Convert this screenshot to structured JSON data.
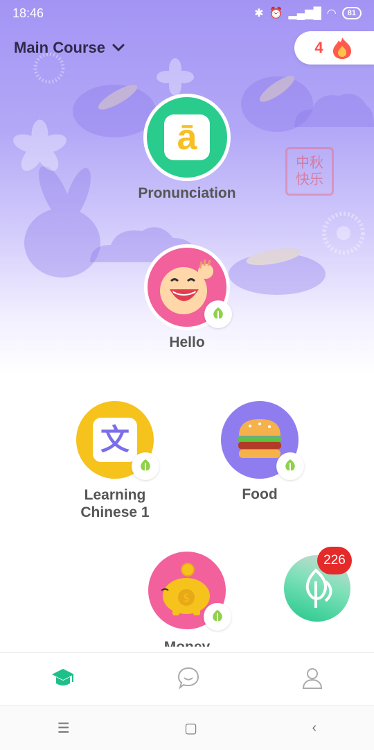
{
  "status_bar": {
    "time": "18:46",
    "battery": "81"
  },
  "header": {
    "course_title": "Main Course",
    "streak_count": "4"
  },
  "lessons": [
    {
      "label": "Pronunciation",
      "icon": "a-macron-icon",
      "glyph": "ā"
    },
    {
      "label": "Hello",
      "icon": "laughing-face-icon"
    },
    {
      "label": "Learning\nChinese 1",
      "icon": "chinese-character-icon",
      "glyph": "文"
    },
    {
      "label": "Food",
      "icon": "burger-icon"
    },
    {
      "label": "Money",
      "icon": "piggy-bank-icon"
    }
  ],
  "decor": {
    "seal_text": "中秋快乐"
  },
  "practice": {
    "badge_count": "226"
  },
  "colors": {
    "accent": "#1ec08a",
    "badge_red": "#e52a2a",
    "streak_red": "#ff4d4d"
  }
}
